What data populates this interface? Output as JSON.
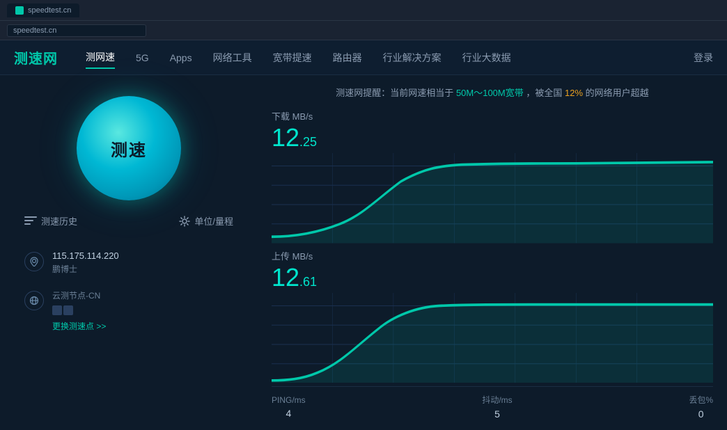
{
  "browser": {
    "tab_label": "speedtest.cn",
    "address": "speedtest.cn"
  },
  "navbar": {
    "logo": "测速网",
    "items": [
      {
        "label": "测网速",
        "active": true
      },
      {
        "label": "5G",
        "active": false
      },
      {
        "label": "Apps",
        "active": false
      },
      {
        "label": "网络工具",
        "active": false
      },
      {
        "label": "宽带提速",
        "active": false
      },
      {
        "label": "路由器",
        "active": false
      },
      {
        "label": "行业解决方案",
        "active": false
      },
      {
        "label": "行业大数据",
        "active": false
      }
    ],
    "login": "登录"
  },
  "left": {
    "speed_button": "测速",
    "history_label": "测速历史",
    "settings_label": "单位/量程",
    "ip": "115.175.114.220",
    "isp": "鹏博士",
    "node_label": "云测节点-CN",
    "change_link": "更换测速点 >>"
  },
  "right": {
    "notice_prefix": "测速网提醒：当前网速相当于",
    "notice_bandwidth": "50M～100M宽带",
    "notice_suffix_pre": "，被全国",
    "notice_percent": "12%",
    "notice_suffix": "的网络用户超越",
    "download_label": "下载 MB/s",
    "download_int": "12",
    "download_dec": ".25",
    "upload_label": "上传 MB/s",
    "upload_int": "12",
    "upload_dec": ".61",
    "stats": [
      {
        "label": "PING/ms",
        "value": "4"
      },
      {
        "label": "抖动/ms",
        "value": "5"
      },
      {
        "label": "丢包%",
        "value": "0"
      }
    ]
  },
  "colors": {
    "accent": "#00c8aa",
    "accent2": "#00e5cc",
    "bg": "#0d1b2a",
    "nav_bg": "#0e1e30",
    "text_secondary": "#8a9bb0"
  }
}
